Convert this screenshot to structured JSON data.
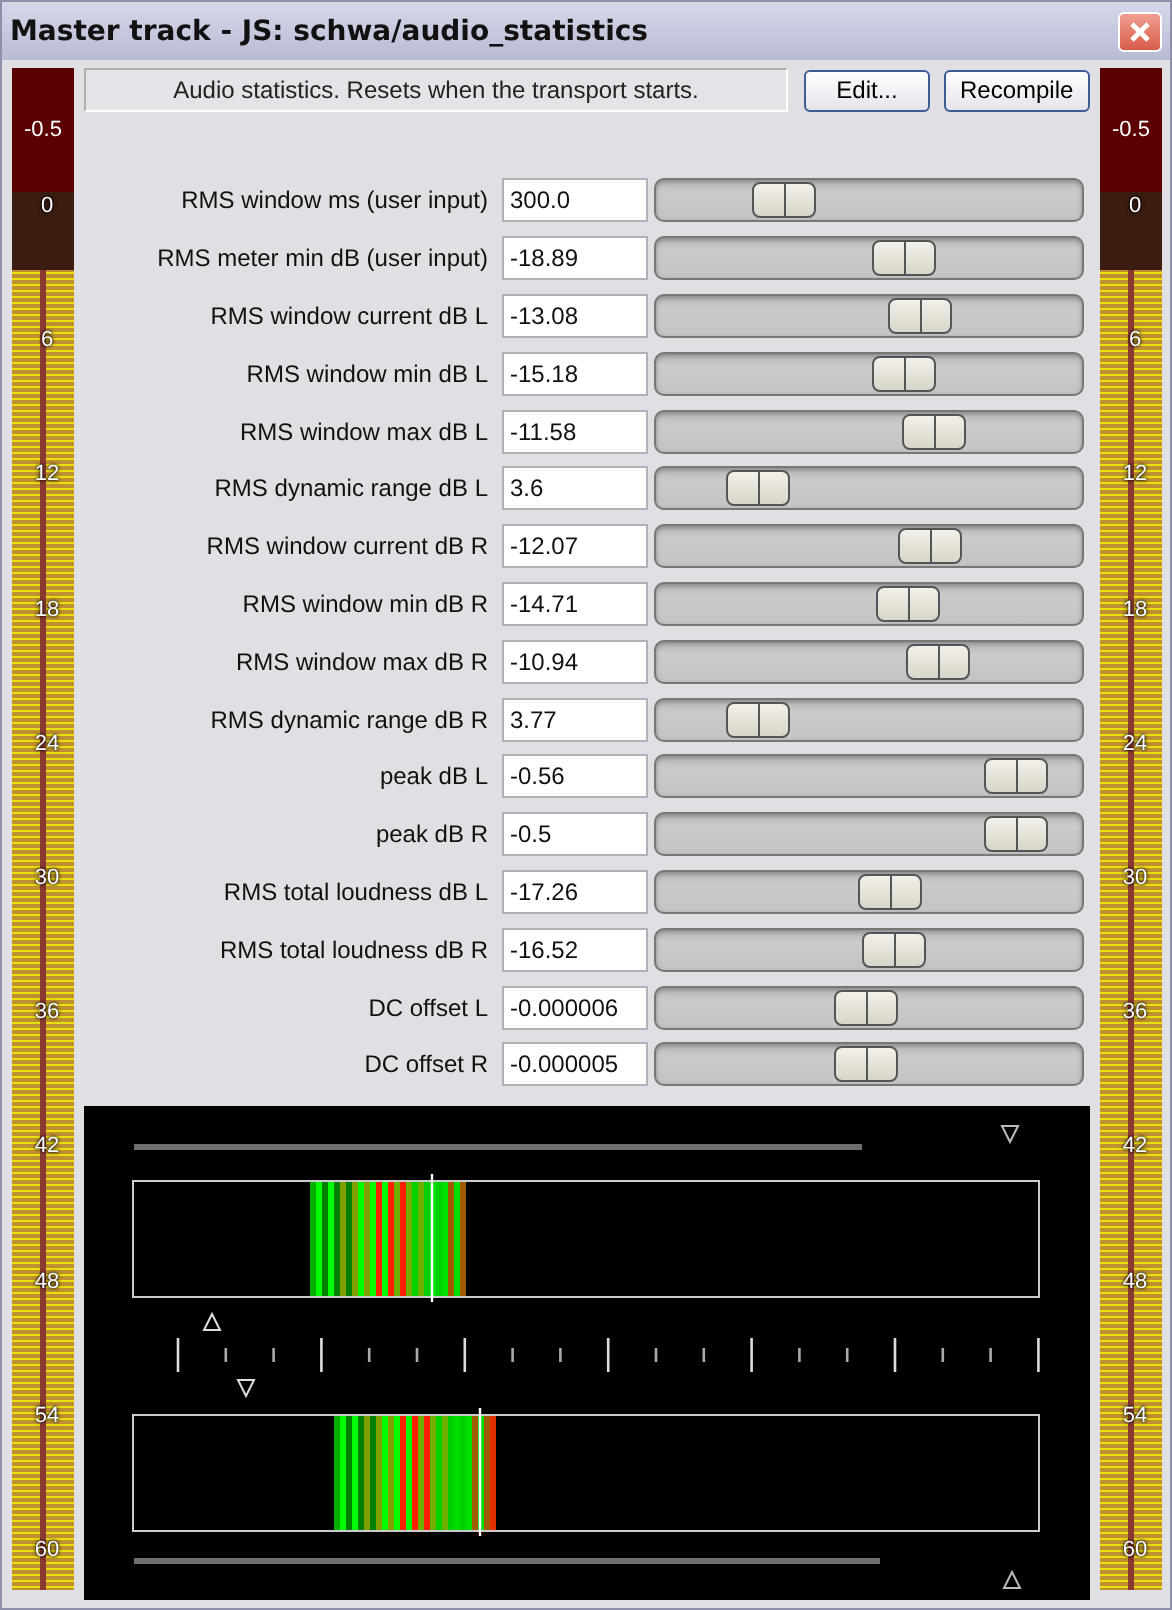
{
  "window": {
    "title": "Master track - JS: schwa/audio_statistics"
  },
  "description": "Audio statistics. Resets when the transport starts.",
  "buttons": [
    "Edit...",
    "Recompile"
  ],
  "meters": [
    {
      "peak": "-0.5",
      "scale": [
        "0",
        "6",
        "12",
        "18",
        "24",
        "30",
        "36",
        "42",
        "48",
        "54",
        "60"
      ]
    },
    {
      "peak": "-0.5",
      "scale": [
        "0",
        "6",
        "12",
        "18",
        "24",
        "30",
        "36",
        "42",
        "48",
        "54",
        "60"
      ]
    }
  ],
  "params": [
    {
      "label": "RMS window ms (user input)",
      "value": "300.0",
      "level": 0.26
    },
    {
      "label": "RMS meter min dB (user input)",
      "value": "-18.89",
      "level": 0.6
    },
    {
      "label": "RMS window current dB L",
      "value": "-13.08",
      "level": 0.64
    },
    {
      "label": "RMS window min dB L",
      "value": "-15.18",
      "level": 0.6
    },
    {
      "label": "RMS window max dB  L",
      "value": "-11.58",
      "level": 0.68
    },
    {
      "label": "RMS dynamic range dB L",
      "value": "3.6",
      "level": 0.19
    },
    {
      "label": "RMS window current dB R",
      "value": "-12.07",
      "level": 0.67
    },
    {
      "label": "RMS window min dB R",
      "value": "-14.71",
      "level": 0.61
    },
    {
      "label": "RMS window max dB R",
      "value": "-10.94",
      "level": 0.69
    },
    {
      "label": "RMS dynamic range dB R",
      "value": "3.77",
      "level": 0.19
    },
    {
      "label": "peak dB L",
      "value": "-0.56",
      "level": 0.91
    },
    {
      "label": "peak dB R",
      "value": "-0.5",
      "level": 0.91
    },
    {
      "label": "RMS total loudness dB L",
      "value": "-17.26",
      "level": 0.56
    },
    {
      "label": "RMS total loudness dB R",
      "value": "-16.52",
      "level": 0.57
    },
    {
      "label": "DC offset L",
      "value": "-0.000006",
      "level": 0.49
    },
    {
      "label": "DC offset R",
      "value": "-0.000005",
      "level": 0.49
    }
  ]
}
